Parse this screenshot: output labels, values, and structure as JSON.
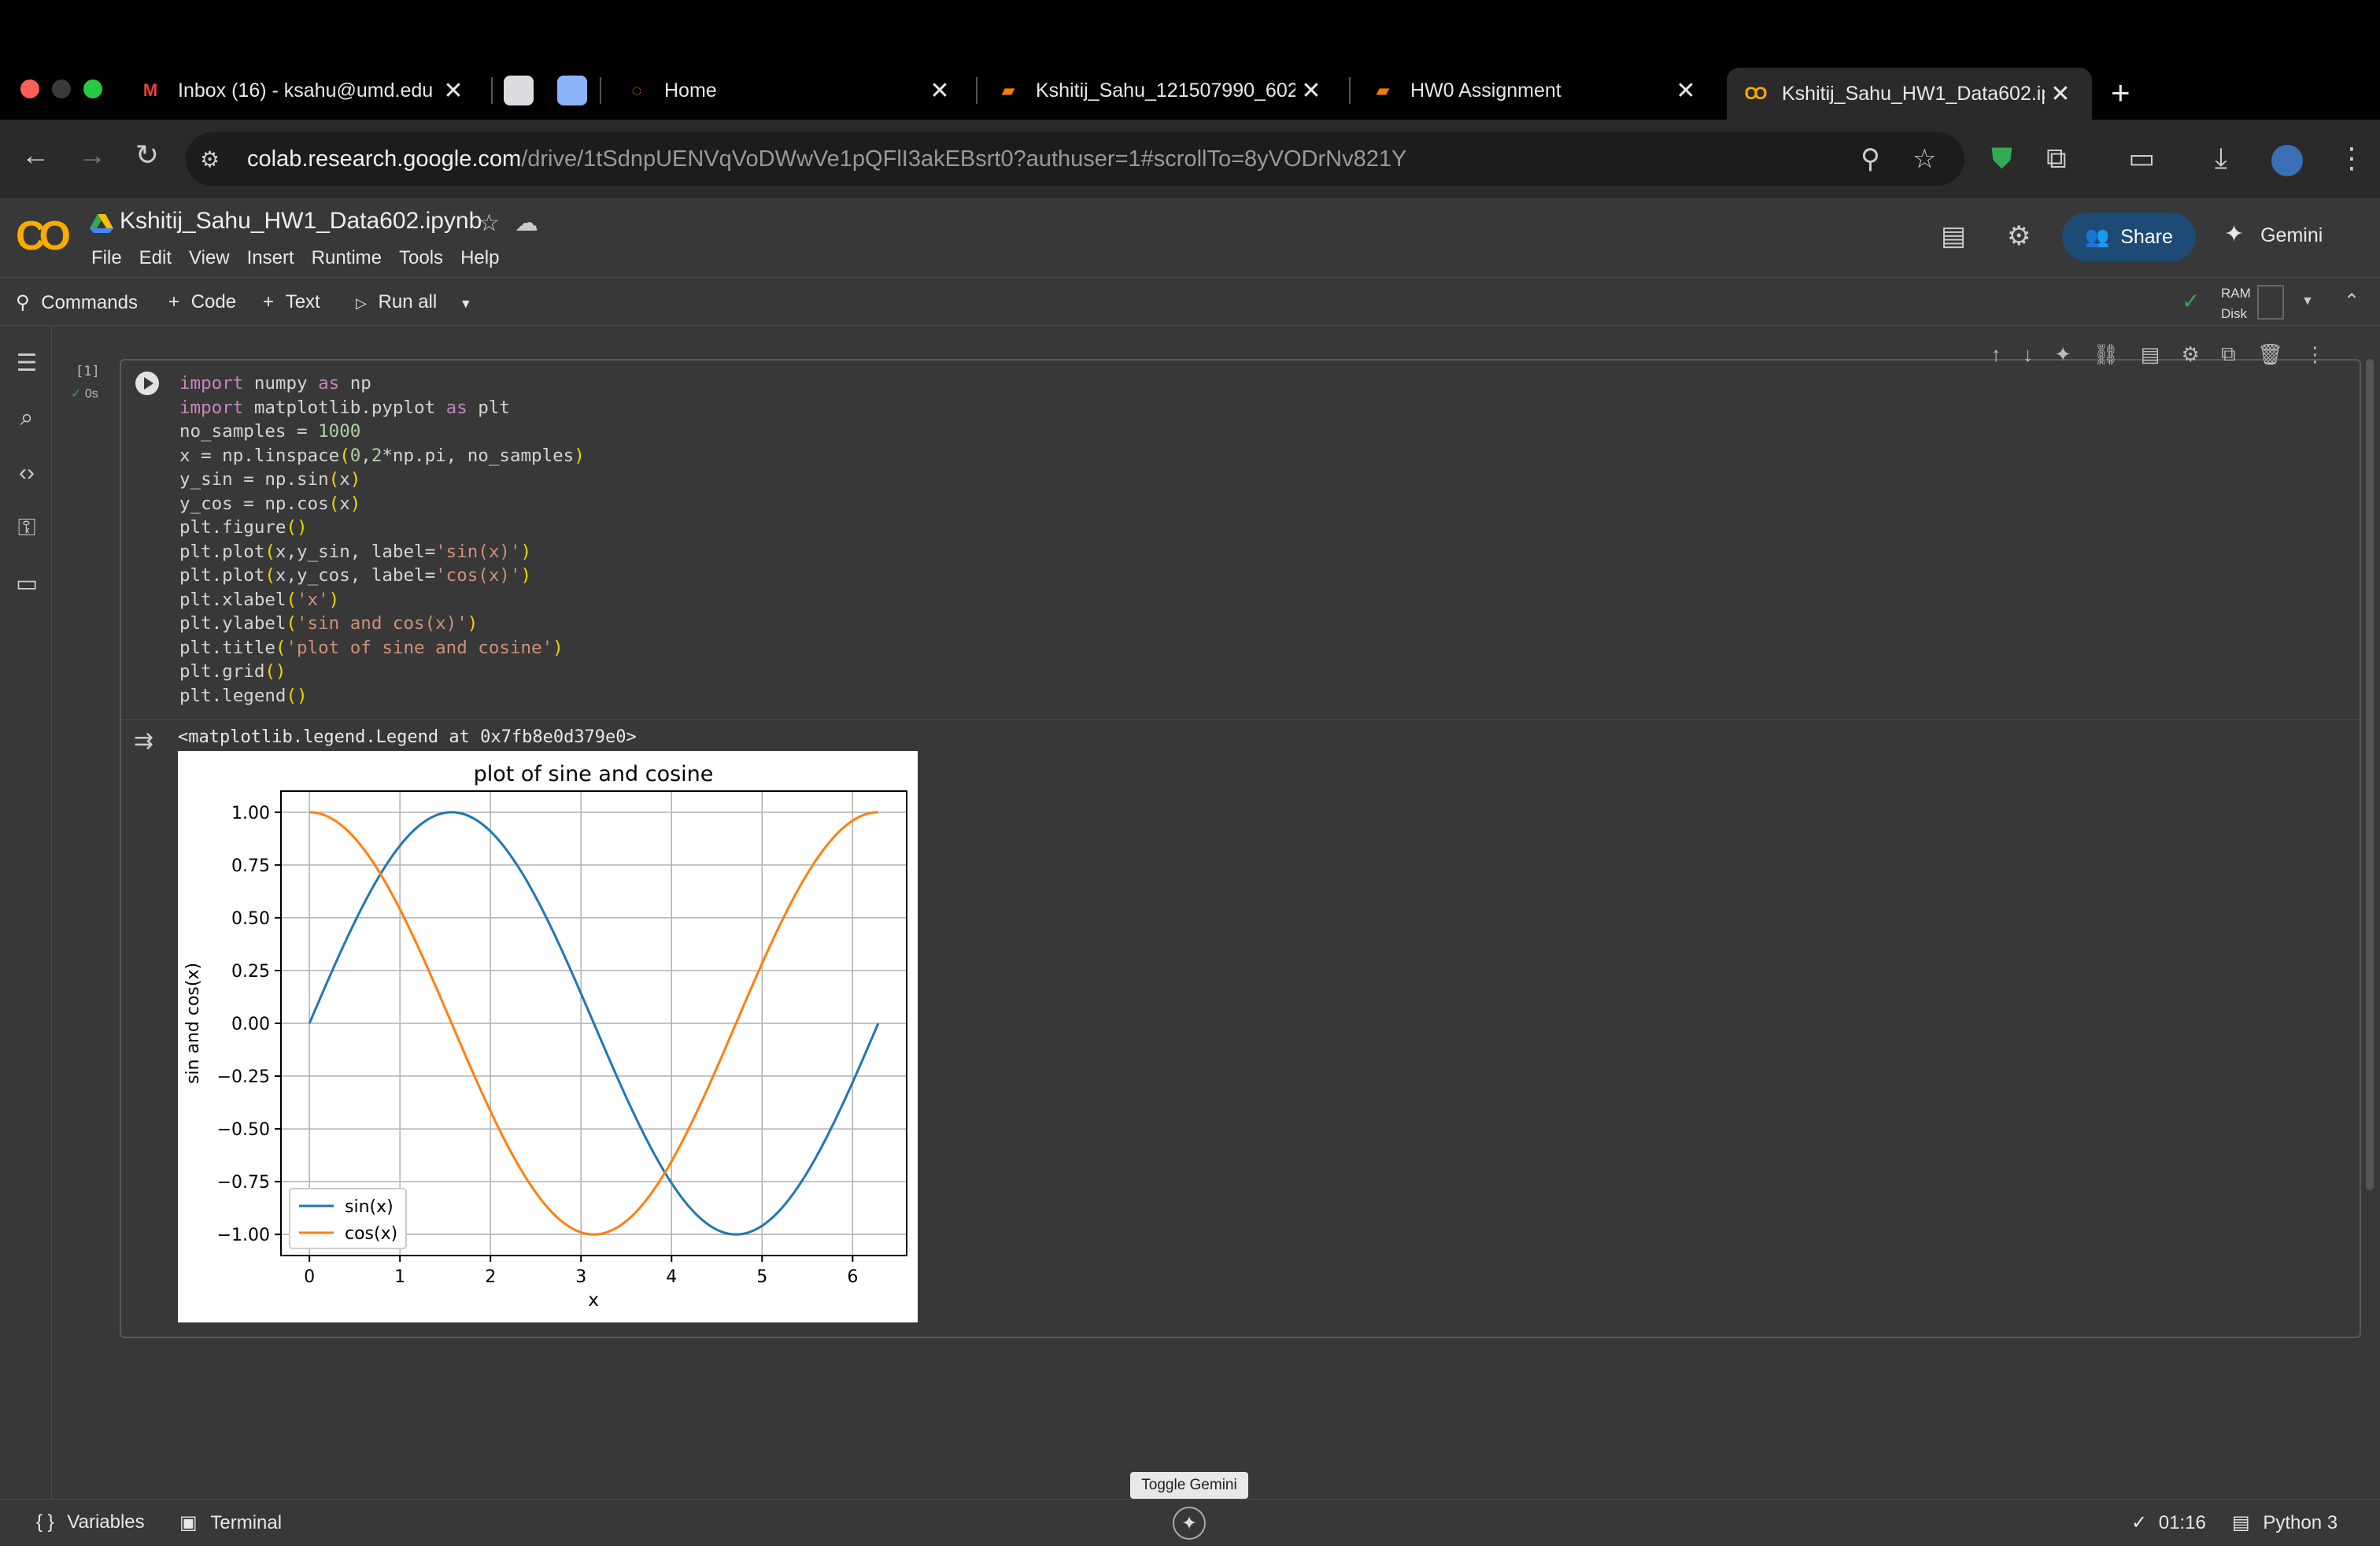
{
  "browser": {
    "tabs": [
      {
        "label": "Inbox (16) - ksahu@umd.edu",
        "favicon": "gmail-icon"
      },
      {
        "label": "Home",
        "favicon": "home-loader-icon"
      },
      {
        "label": "Kshitij_Sahu_121507990_602",
        "favicon": "book-icon"
      },
      {
        "label": "HW0 Assignment",
        "favicon": "book-icon"
      },
      {
        "label": "Kshitij_Sahu_HW1_Data602.ip",
        "favicon": "colab-icon",
        "active": true
      }
    ],
    "url_host": "colab.research.google.com",
    "url_path": "/drive/1tSdnpUENVqVoDWwVe1pQFlI3akEBsrt0?authuser=1#scrollTo=8yVODrNv821Y"
  },
  "colab": {
    "logo": "CO",
    "notebook_title": "Kshitij_Sahu_HW1_Data602.ipynb",
    "menu": [
      "File",
      "Edit",
      "View",
      "Insert",
      "Runtime",
      "Tools",
      "Help"
    ],
    "share_label": "Share",
    "gemini_label": "Gemini",
    "toolbar": {
      "commands": "Commands",
      "code": "Code",
      "text": "Text",
      "run_all": "Run all",
      "ram": "RAM",
      "disk": "Disk"
    },
    "cell": {
      "exec_count": "[1]",
      "exec_time": "0s",
      "output_text": "<matplotlib.legend.Legend at 0x7fb8e0d379e0>"
    },
    "statusbar": {
      "variables": "Variables",
      "terminal": "Terminal",
      "tooltip": "Toggle Gemini",
      "time": "01:16",
      "runtime": "Python 3"
    }
  },
  "chart_data": {
    "type": "line",
    "title": "plot of sine and cosine",
    "xlabel": "x",
    "ylabel": "sin and cos(x)",
    "xlim": [
      -0.314,
      6.597
    ],
    "ylim": [
      -1.1,
      1.1
    ],
    "xticks": [
      "0",
      "1",
      "2",
      "3",
      "4",
      "5",
      "6"
    ],
    "yticks": [
      "1.00",
      "0.75",
      "0.50",
      "0.25",
      "0.00",
      "−0.25",
      "−0.50",
      "−0.75",
      "−1.00"
    ],
    "grid": true,
    "legend_position": "lower-left",
    "x_range": [
      0,
      6.2832
    ],
    "series": [
      {
        "name": "sin(x)",
        "function": "sin",
        "color": "#1f77b4"
      },
      {
        "name": "cos(x)",
        "function": "cos",
        "color": "#ff7f0e"
      }
    ]
  }
}
